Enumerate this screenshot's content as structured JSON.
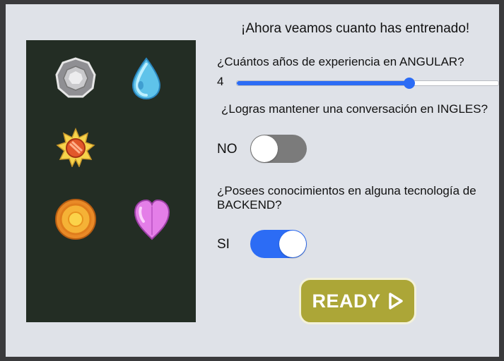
{
  "title": "¡Ahora veamos cuanto has entrenado!",
  "questions": {
    "angular": {
      "label": "¿Cuántos años de experiencia en ANGULAR?",
      "value": "4",
      "slider_fraction": 0.66
    },
    "ingles": {
      "label": "¿Logras mantener una conversación en INGLES?",
      "toggle_text": "NO",
      "toggle_on": false
    },
    "backend": {
      "label": "¿Posees conocimientos en alguna tecnología de BACKEND?",
      "toggle_text": "SI",
      "toggle_on": true
    }
  },
  "ready_button": {
    "label": "READY",
    "icon": "play-outline-icon"
  },
  "badges": [
    {
      "name": "boulder-badge-icon",
      "color": "#b9b9b9"
    },
    {
      "name": "cascade-badge-icon",
      "color": "#5fc3ea"
    },
    {
      "name": "volcano-badge-icon",
      "color": "#f2c12e"
    },
    {
      "name": "soul-badge-icon",
      "color": "#f3a23a"
    },
    {
      "name": "rainbow-heart-badge-icon",
      "color": "#e47ee8"
    }
  ],
  "colors": {
    "accent": "#2c6cf5",
    "ready_bg": "#aca637",
    "panel_bg": "#dfe2e8",
    "badge_box_bg": "#232d24"
  }
}
